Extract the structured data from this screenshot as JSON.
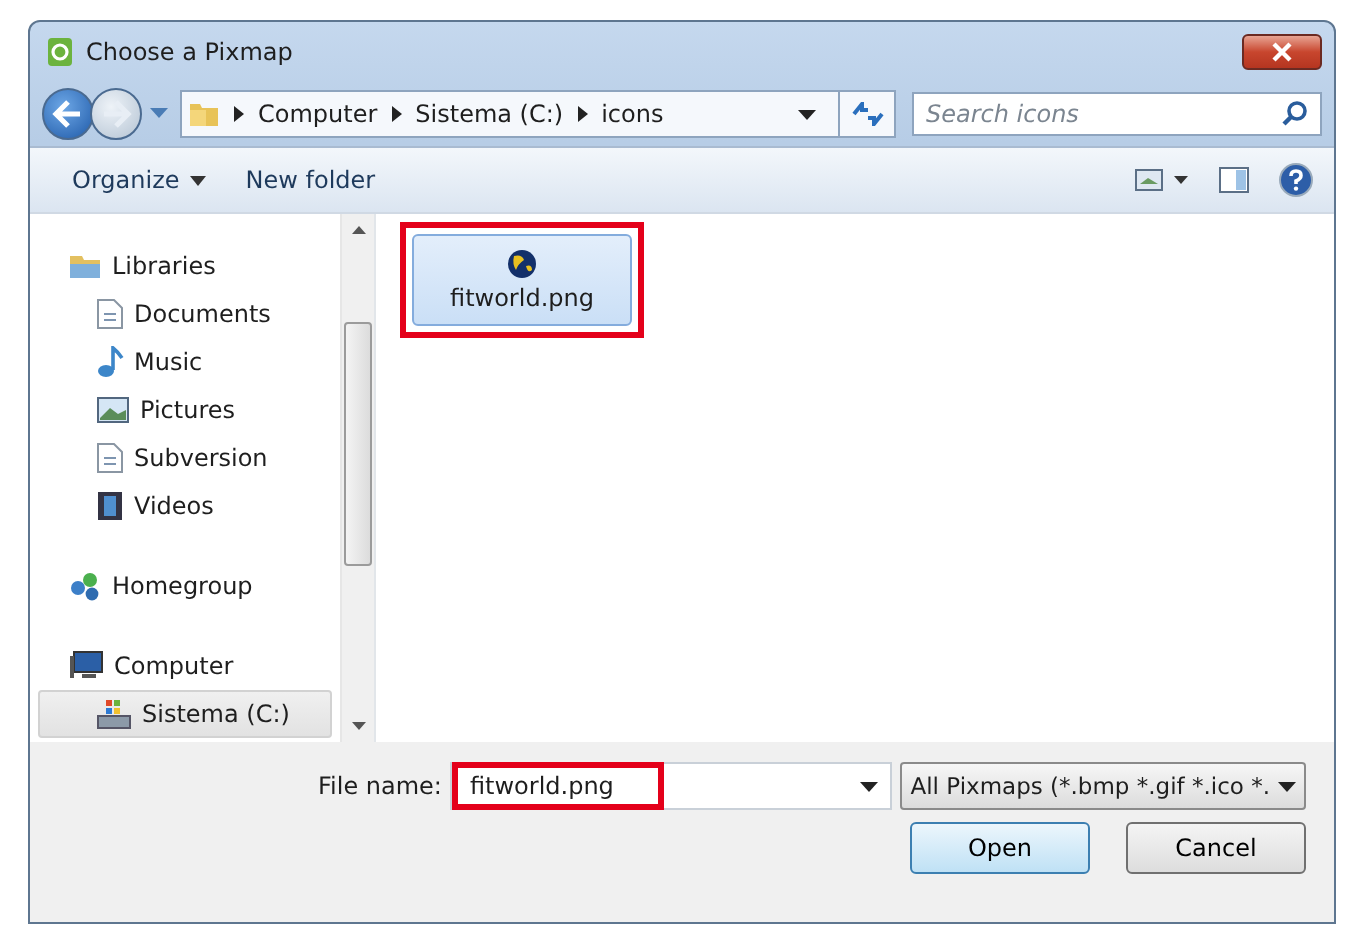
{
  "window": {
    "title": "Choose a Pixmap"
  },
  "breadcrumb": [
    "Computer",
    "Sistema (C:)",
    "icons"
  ],
  "search": {
    "placeholder": "Search icons"
  },
  "toolbar": {
    "organize": "Organize",
    "new_folder": "New folder"
  },
  "sidebar": {
    "items": [
      {
        "label": "Libraries",
        "kind": "group",
        "selected": false
      },
      {
        "label": "Documents",
        "kind": "sub",
        "selected": false
      },
      {
        "label": "Music",
        "kind": "sub",
        "selected": false
      },
      {
        "label": "Pictures",
        "kind": "sub",
        "selected": false
      },
      {
        "label": "Subversion",
        "kind": "sub",
        "selected": false
      },
      {
        "label": "Videos",
        "kind": "sub",
        "selected": false
      },
      {
        "label": "Homegroup",
        "kind": "group",
        "selected": false
      },
      {
        "label": "Computer",
        "kind": "group",
        "selected": false
      },
      {
        "label": "Sistema (C:)",
        "kind": "sub",
        "selected": true
      }
    ]
  },
  "files": [
    {
      "name": "fitworld.png",
      "selected": true,
      "highlighted": true
    }
  ],
  "file_name": {
    "label": "File name:",
    "value": "fitworld.png",
    "highlighted": true
  },
  "filter": {
    "value": "All Pixmaps (*.bmp *.gif *.ico *."
  },
  "buttons": [
    "Open",
    "Cancel"
  ]
}
